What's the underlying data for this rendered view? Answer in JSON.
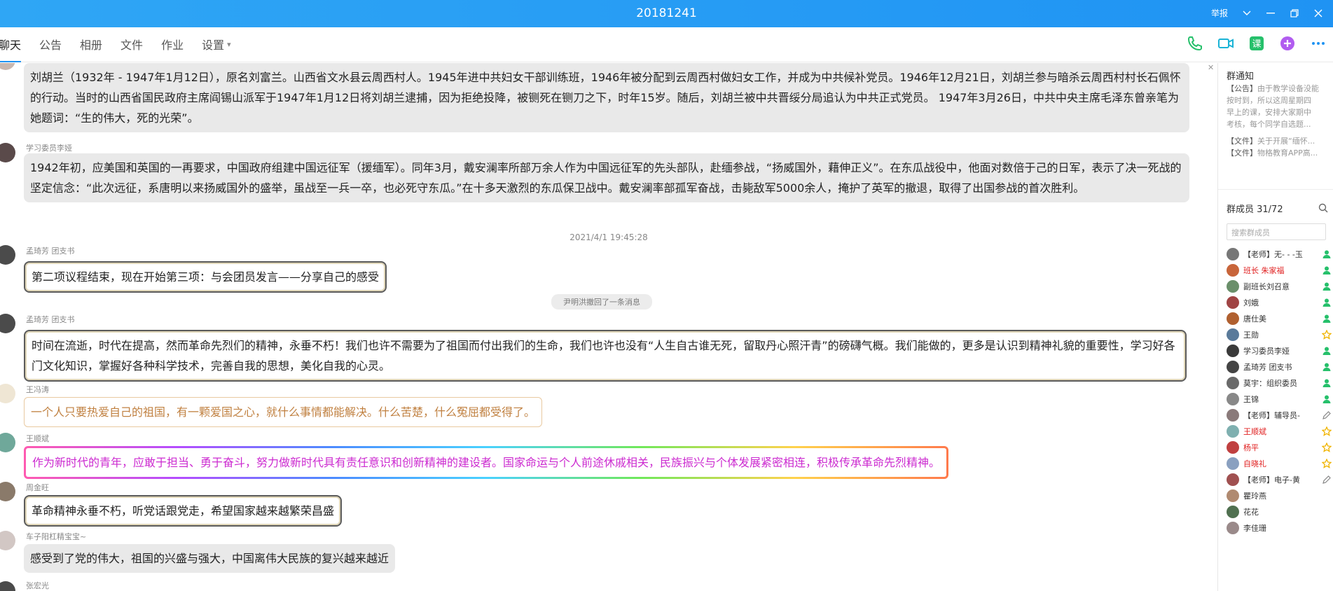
{
  "window": {
    "title": "20181241",
    "report_label": "举报"
  },
  "tabs": [
    {
      "label": "聊天"
    },
    {
      "label": "公告"
    },
    {
      "label": "相册"
    },
    {
      "label": "文件"
    },
    {
      "label": "作业"
    },
    {
      "label": "设置"
    }
  ],
  "messages": [
    {
      "sender": "",
      "text": "刘胡兰（1932年 - 1947年1月12日），原名刘富兰。山西省文水县云周西村人。1945年进中共妇女干部训练班，1946年被分配到云周西村做妇女工作，并成为中共候补党员。1946年12月21日，刘胡兰参与暗杀云周西村村长石佩怀的行动。当时的山西省国民政府主席阎锡山派军于1947年1月12日将刘胡兰逮捕，因为拒绝投降，被铡死在铡刀之下，时年15岁。随后，刘胡兰被中共晋绥分局追认为中共正式党员。    1947年3月26日，中共中央主席毛泽东曾亲笔为她题词：“生的伟大，死的光荣”。"
    },
    {
      "sender": "学习委员李娅",
      "text": "1942年初，应美国和英国的一再要求，中国政府组建中国远征军（援缅军）。同年3月，戴安澜率所部万余人作为中国远征军的先头部队，赴缅参战，“扬威国外，藉伸正义”。在东瓜战役中，他面对数倍于己的日军，表示了决一死战的坚定信念：“此次远征，系唐明以来扬威国外的盛举，虽战至一兵一卒，也必死守东瓜。”在十多天激烈的东瓜保卫战中。戴安澜率部孤军奋战，击毙敌军5000余人，掩护了英军的撤退，取得了出国参战的首次胜利。"
    },
    {
      "sender": "孟琦芳 团支书",
      "text": "第二项议程结束，现在开始第三项：与会团员发言——分享自己的感受"
    },
    {
      "sender": "孟琦芳 团支书",
      "text": "时间在流逝，时代在提高，然而革命先烈们的精神，永垂不朽！我们也许不需要为了祖国而付出我们的生命，我们也许也没有“人生自古谁无死，留取丹心照汗青”的磅礴气概。我们能做的，更多是认识到精神礼貌的重要性，学习好各门文化知识，掌握好各种科学技术，完善自我的思想，美化自我的心灵。"
    },
    {
      "sender": "王冯涛",
      "text": "一个人只要热爱自己的祖国，有一颗爱国之心，就什么事情都能解决。什么苦楚，什么冤屈都受得了。"
    },
    {
      "sender": "王顺斌",
      "text": "作为新时代的青年，应敢于担当、勇于奋斗，努力做新时代具有责任意识和创新精神的建设者。国家命运与个人前途休戚相关，民族振兴与个体发展紧密相连，积极传承革命先烈精神。"
    },
    {
      "sender": "周金旺",
      "text": "革命精神永垂不朽，听党话跟党走，希望国家越来越繁荣昌盛"
    },
    {
      "sender": "车子阳杠精宝宝~",
      "text": "感受到了党的伟大，祖国的兴盛与强大，中国离伟大民族的复兴越来越近"
    },
    {
      "sender": "张宏光",
      "text": ""
    }
  ],
  "timestamp": "2021/4/1 19:45:28",
  "recall_notice": "尹明洪撤回了一条消息",
  "panel": {
    "notice_title": "群通知",
    "notice_announcement_tag": "【公告】",
    "notice_announcement_lines": [
      "由于教学设备没能",
      "按时到，所以这周星期四",
      "早上的课，安排大家期中",
      "考核，每个同学自选题..."
    ],
    "notice_file1_tag": "【文件】",
    "notice_file1": "关于开展“缅怀...",
    "notice_file2_tag": "【文件】",
    "notice_file2": "物格教育APP高...",
    "members_title": "群成员 31/72",
    "search_placeholder": "搜索群成员",
    "members": [
      {
        "name": "【老师】无- - -玉",
        "red": false,
        "icon": "person"
      },
      {
        "name": "班长  朱家福",
        "red": true,
        "icon": "person"
      },
      {
        "name": "副班长刘召意",
        "red": false,
        "icon": "person"
      },
      {
        "name": "刘娥",
        "red": false,
        "icon": "person"
      },
      {
        "name": "唐仕美",
        "red": false,
        "icon": "person"
      },
      {
        "name": "王勋",
        "red": false,
        "icon": "star"
      },
      {
        "name": "学习委员李娅",
        "red": false,
        "icon": "person"
      },
      {
        "name": "孟琦芳 团支书",
        "red": false,
        "icon": "person"
      },
      {
        "name": "莫宇：组织委员",
        "red": false,
        "icon": "person"
      },
      {
        "name": "王锦",
        "red": false,
        "icon": "person"
      },
      {
        "name": "【老师】辅导员-",
        "red": false,
        "icon": "edit"
      },
      {
        "name": "王顺斌",
        "red": true,
        "icon": "star"
      },
      {
        "name": "杨平",
        "red": true,
        "icon": "star"
      },
      {
        "name": "自晓礼",
        "red": true,
        "icon": "star"
      },
      {
        "name": "【老师】电子-黄",
        "red": false,
        "icon": "edit"
      },
      {
        "name": "瞿玲燕",
        "red": false,
        "icon": "none"
      },
      {
        "name": "花花",
        "red": false,
        "icon": "none"
      },
      {
        "name": "李佳珊",
        "red": false,
        "icon": "none"
      }
    ]
  },
  "colors": {
    "titlebar": "#1f93f3",
    "accent_green": "#26c06b",
    "accent_purple": "#b15cf0",
    "red_name": "#e02020"
  }
}
